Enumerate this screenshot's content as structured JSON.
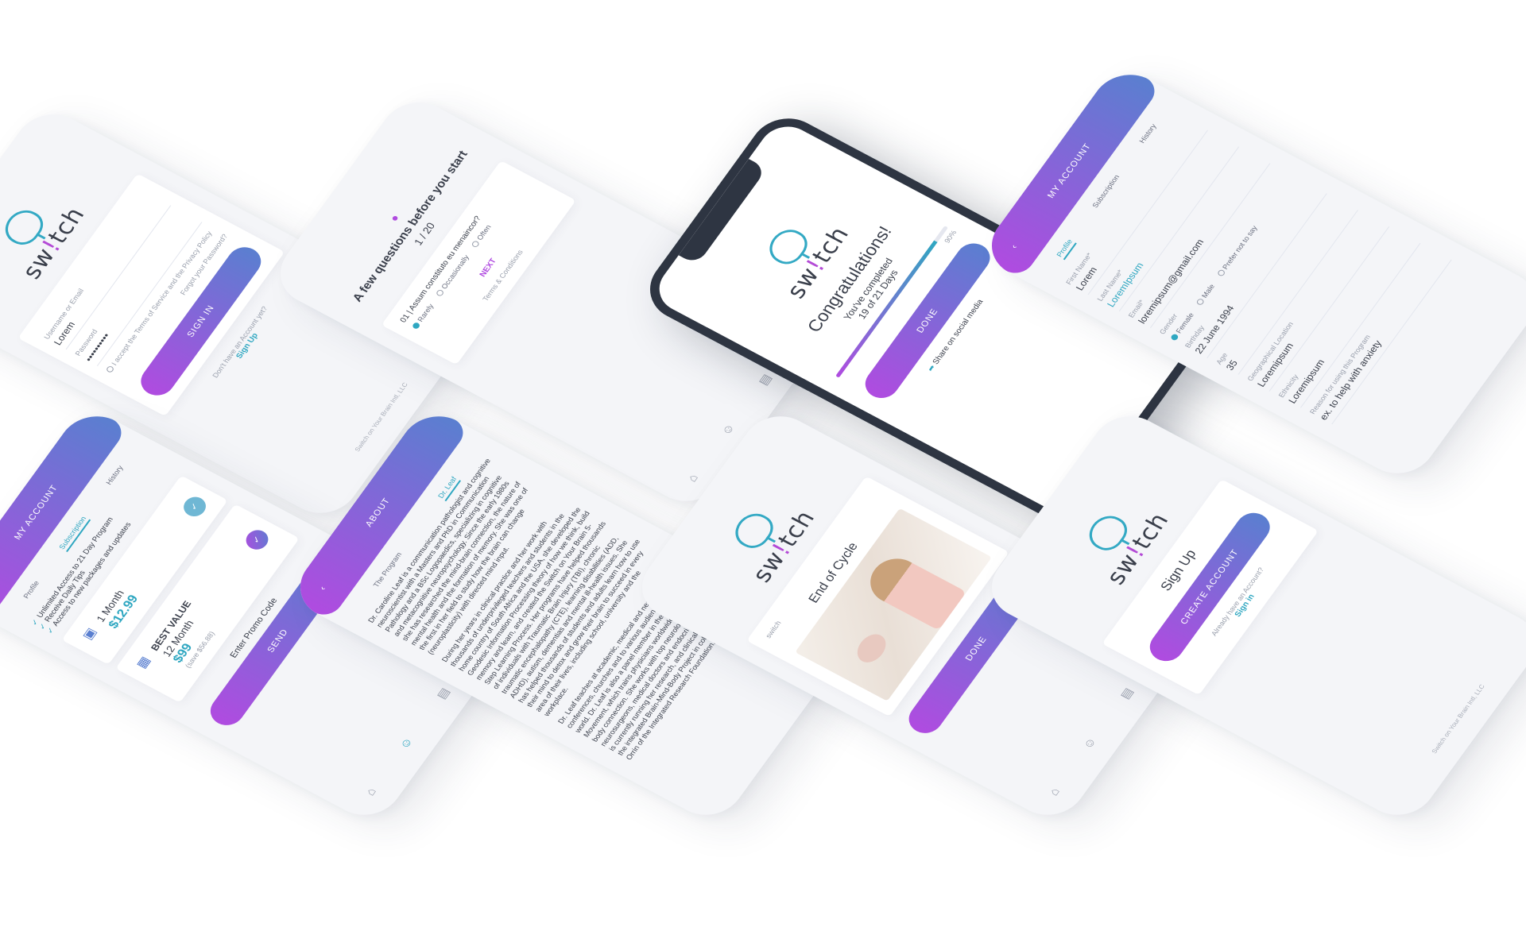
{
  "brand": {
    "wordmark_start": "sw",
    "wordmark_dot": "!",
    "wordmark_end": "tch",
    "accent": "#b04be0",
    "accent_2": "#5a7fd0",
    "teal": "#2fa7c1"
  },
  "login": {
    "username_label": "Username or Email",
    "username_value": "Lorem",
    "password_label": "Password",
    "password_value": "••••••••••",
    "terms_text": "I accept the Terms of Service and the Privacy Policy",
    "forgot": "Forgot your Password?",
    "sign_in": "SIGN IN",
    "no_account": "Don't have an Account yet?",
    "sign_up_link": "Sign Up",
    "footer": "Switch on Your Brain Intl, LLC"
  },
  "questions": {
    "title": "A few questions before you start",
    "counter": "1 / 20",
    "question": "01 | Assum constituto eu menaincor?",
    "options": [
      "Rarely",
      "Occasionally",
      "Often"
    ],
    "next": "NEXT",
    "terms": "Terms & Conditions"
  },
  "congrats": {
    "title": "Congratulations!",
    "subtitle": "You've completed",
    "days": "19 of 21 Days",
    "progress": 0.9,
    "percent": "90%",
    "done": "DONE",
    "share": "Share on social media"
  },
  "profile": {
    "header": "MY ACCOUNT",
    "tabs": [
      "Profile",
      "Subscription",
      "History"
    ],
    "first_name_label": "First Name*",
    "first_name": "Lorem",
    "last_name_label": "Last Name*",
    "last_name": "LoremIpsum",
    "email_label": "Email*",
    "email": "loremipsum@gmail.com",
    "gender_label": "Gender",
    "genders": [
      "Female",
      "Male",
      "Prefer not to say"
    ],
    "birthday_label": "Birthday",
    "birthday": "22 June 1994",
    "age_label": "Age",
    "age": "35",
    "location_label": "Geographical Location",
    "location": "Loremipsum",
    "ethnicity_label": "Ethnicity",
    "ethnicity": "Loremipsum",
    "reason_label": "Reason for using this Program",
    "reason": "ex. to help with anxiety"
  },
  "subscription": {
    "header": "MY ACCOUNT",
    "tabs": [
      "Profile",
      "Subscription",
      "History"
    ],
    "benefits": [
      "Unlimited Access to 21 Day Program",
      "Receive Daily Tips",
      "Access to new packages and updates"
    ],
    "plan1_name": "1 Month",
    "plan1_price": "$12.99",
    "plan2_badge": "BEST VALUE",
    "plan2_name": "12 Month",
    "plan2_price": "$99",
    "plan2_save": "(save $56.88)",
    "promo": "Enter Promo Code",
    "send": "SEND"
  },
  "about": {
    "header": "ABOUT",
    "tabs": [
      "The Program",
      "Dr. Leaf"
    ],
    "p1": "Dr. Caroline Leaf is a communication pathologist and cognitive neuroscientist with a Masters and PhD in Communication Pathology and a BSc Logopaedics, specializing in cognitive and metacognitive neuropsychology. Since the early 1980s she has researched the mind-brain connection, the nature of mental health and the formation of memory. She was one of the first in her field to study how the brain can change (neuroplasticity) with directed mind input.",
    "p2": "During her years in clinical practice and her work with thousands of underprivileged teachers and students in the home country of South Africa and the USA, she developed the Geodesic Information Processing theory of how we think, build memory and learn, and created the Switch on Your Brain 5-Step Learning Process. Her programs have helped thousands of individuals with Traumatic Brain Injury (TBI), chronic traumatic encephalopathy (CTE), learning disabilities (ADD, ADHD), autism, dementias and mental ill-health issues. She has helped thousands of students and adults learn how to use their mind to detox and grow their brain to succeed in every area of their lives, including school, university and the workplace.",
    "p3": "Dr. Leaf teaches at academic, medical and neuroscience conferences, churches and to various audiences around the world. Dr. Leaf is also a panel member in the Global EMDR Movement, which trains physicians worldwide on the mind-body connection. She works with top neurologists, neurosurgeons, medical doctors and endocrinologists, and she is currently running her research, and clinical trials with ON in the integrated Brain-Mind-Body Project in collaboration with Orrin of the Integrated Research Foundation."
  },
  "end_cycle": {
    "title": "End of Cycle",
    "caption": "switch",
    "done": "DONE"
  },
  "signup": {
    "title": "Sign Up",
    "create": "CREATE ACCOUNT",
    "already": "Already have an Account?",
    "sign_in": "Sign in",
    "footer": "Switch on Your Brain Intl, LLC"
  }
}
